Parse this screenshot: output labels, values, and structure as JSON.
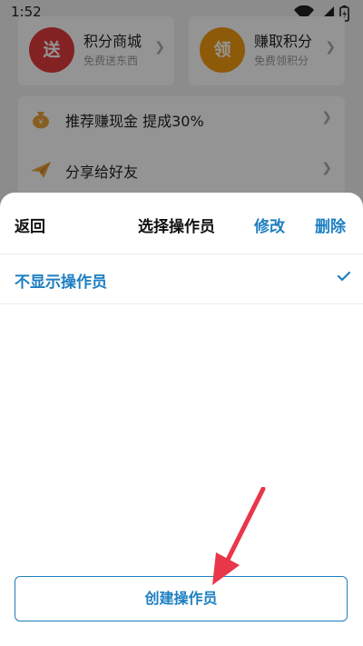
{
  "status_bar": {
    "time": "1:52"
  },
  "background": {
    "card_left": {
      "badge": "送",
      "title": "积分商城",
      "subtitle": "免费送东西",
      "badge_color": "#e23b3b"
    },
    "card_right": {
      "badge": "领",
      "title": "赚取积分",
      "subtitle": "免费领积分",
      "badge_color": "#f39c12"
    },
    "list": [
      {
        "label": "推荐赚现金  提成30%",
        "icon": "money-bag-icon"
      },
      {
        "label": "分享给好友",
        "icon": "paper-plane-icon"
      }
    ]
  },
  "sheet": {
    "back_label": "返回",
    "title": "选择操作员",
    "edit_label": "修改",
    "delete_label": "删除",
    "option_label": "不显示操作员",
    "create_label": "创建操作员"
  },
  "colors": {
    "accent": "#1d7fc1",
    "annotation_arrow": "#e8374a"
  }
}
